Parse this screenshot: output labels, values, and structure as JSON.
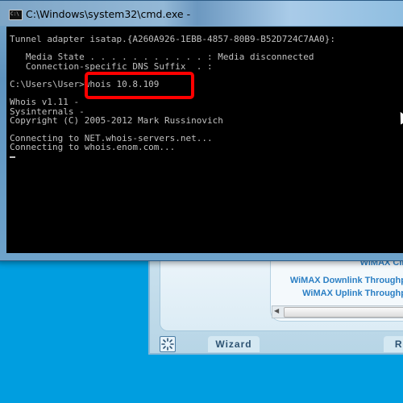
{
  "window": {
    "title": "C:\\Windows\\system32\\cmd.exe -",
    "icon": "cmd-icon",
    "icon_text": "C:\\"
  },
  "console": {
    "lines": [
      "Tunnel adapter isatap.{A260A926-1EBB-4857-80B9-B52D724C7AA0}:",
      "",
      "   Media State . . . . . . . . . . . : Media disconnected",
      "   Connection-specific DNS Suffix  . :",
      "",
      "C:\\Users\\User>whois 10.8.109",
      "",
      "Whois v1.11 -",
      "Sysinternals -",
      "Copyright (C) 2005-2012 Mark Russinovich",
      "",
      "Connecting to NET.whois-servers.net...",
      "Connecting to whois.enom.com..."
    ],
    "highlighted_command": "whois 10.8.109"
  },
  "background_app": {
    "stats": [
      "WiMAX CINR:",
      "WiMAX Downlink Throughput:",
      "WiMAX Uplink Throughput:"
    ],
    "buttons": {
      "wizard": "Wizard",
      "refresh": "Ref"
    }
  },
  "colors": {
    "desktop": "#009ee0",
    "highlight": "#ff0000",
    "console_bg": "#000000",
    "console_fg": "#c0c0c0"
  }
}
